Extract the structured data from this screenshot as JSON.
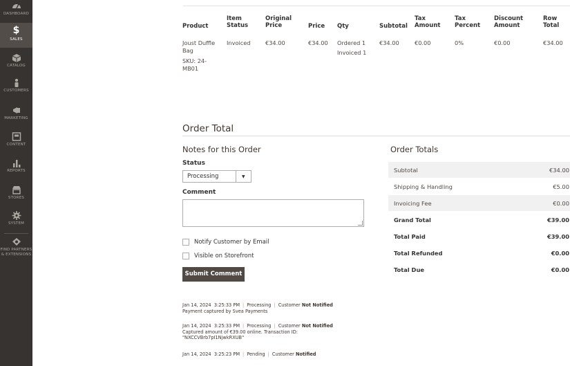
{
  "nav": [
    {
      "label": "DASHBOARD",
      "icon": "gauge-icon"
    },
    {
      "label": "SALES",
      "icon": "dollar-icon",
      "glyph": "$",
      "active": true
    },
    {
      "label": "CATALOG",
      "icon": "cube-icon"
    },
    {
      "label": "CUSTOMERS",
      "icon": "person-icon"
    },
    {
      "label": "MARKETING",
      "icon": "megaphone-icon"
    },
    {
      "label": "CONTENT",
      "icon": "layout-icon"
    },
    {
      "label": "REPORTS",
      "icon": "bar-chart-icon"
    },
    {
      "label": "STORES",
      "icon": "storefront-icon"
    },
    {
      "label": "SYSTEM",
      "icon": "gear-icon"
    },
    {
      "label": "FIND PARTNERS",
      "label2": "& EXTENSIONS",
      "icon": "extensions-icon"
    }
  ],
  "items_table": {
    "headers": {
      "product": "Product",
      "item_status_1": "Item",
      "item_status_2": "Status",
      "original_price_1": "Original",
      "original_price_2": "Price",
      "price": "Price",
      "qty": "Qty",
      "subtotal": "Subtotal",
      "tax_amount_1": "Tax",
      "tax_amount_2": "Amount",
      "tax_percent_1": "Tax",
      "tax_percent_2": "Percent",
      "discount_1": "Discount",
      "discount_2": "Amount",
      "row_total_1": "Row",
      "row_total_2": "Total"
    },
    "row": {
      "product_line1": "Joust Duffle",
      "product_line2": "Bag",
      "sku_line1": "SKU: 24-",
      "sku_line2": "MB01",
      "item_status": "Invoiced",
      "original_price": "€34.00",
      "price": "€34.00",
      "qty_ordered": "Ordered 1",
      "qty_invoiced": "Invoiced 1",
      "subtotal": "€34.00",
      "tax_amount": "€0.00",
      "tax_percent": "0%",
      "discount": "€0.00",
      "row_total": "€34.00"
    }
  },
  "order_total": {
    "title": "Order Total",
    "notes_title": "Notes for this Order",
    "status_label": "Status",
    "status_value": "Processing",
    "comment_label": "Comment",
    "notify_label": "Notify Customer by Email",
    "visible_label": "Visible on Storefront",
    "submit_label": "Submit Comment"
  },
  "history": [
    {
      "date": "Jan 14, 2024",
      "time": "3:25:33 PM",
      "status": "Processing",
      "customer": "Customer",
      "notified": "Not Notified",
      "line1": "Payment captured by Svea Payments",
      "line2": ""
    },
    {
      "date": "Jan 14, 2024",
      "time": "3:25:33 PM",
      "status": "Processing",
      "customer": "Customer",
      "notified": "Not Notified",
      "line1": "Captured amount of €39.00 online. Transaction ID:",
      "line2": "\"NXCCVBrb7pI1NjwkRXUB\""
    },
    {
      "date": "Jan 14, 2024",
      "time": "3:25:23 PM",
      "status": "Pending",
      "customer": "Customer",
      "notified": "Notified",
      "line1": "",
      "line2": ""
    }
  ],
  "totals": {
    "title": "Order Totals",
    "rows": [
      {
        "label": "Subtotal",
        "value": "€34.00"
      },
      {
        "label": "Shipping & Handling",
        "value": "€5.00"
      },
      {
        "label": "Invoicing Fee",
        "value": "€0.00"
      },
      {
        "label": "Grand Total",
        "value": "€39.00"
      },
      {
        "label": "Total Paid",
        "value": "€39.00"
      },
      {
        "label": "Total Refunded",
        "value": "€0.00"
      },
      {
        "label": "Total Due",
        "value": "€0.00"
      }
    ]
  },
  "colors": {
    "sidebar": "#373330",
    "sidebar_active": "#524d49",
    "button": "#514943"
  }
}
